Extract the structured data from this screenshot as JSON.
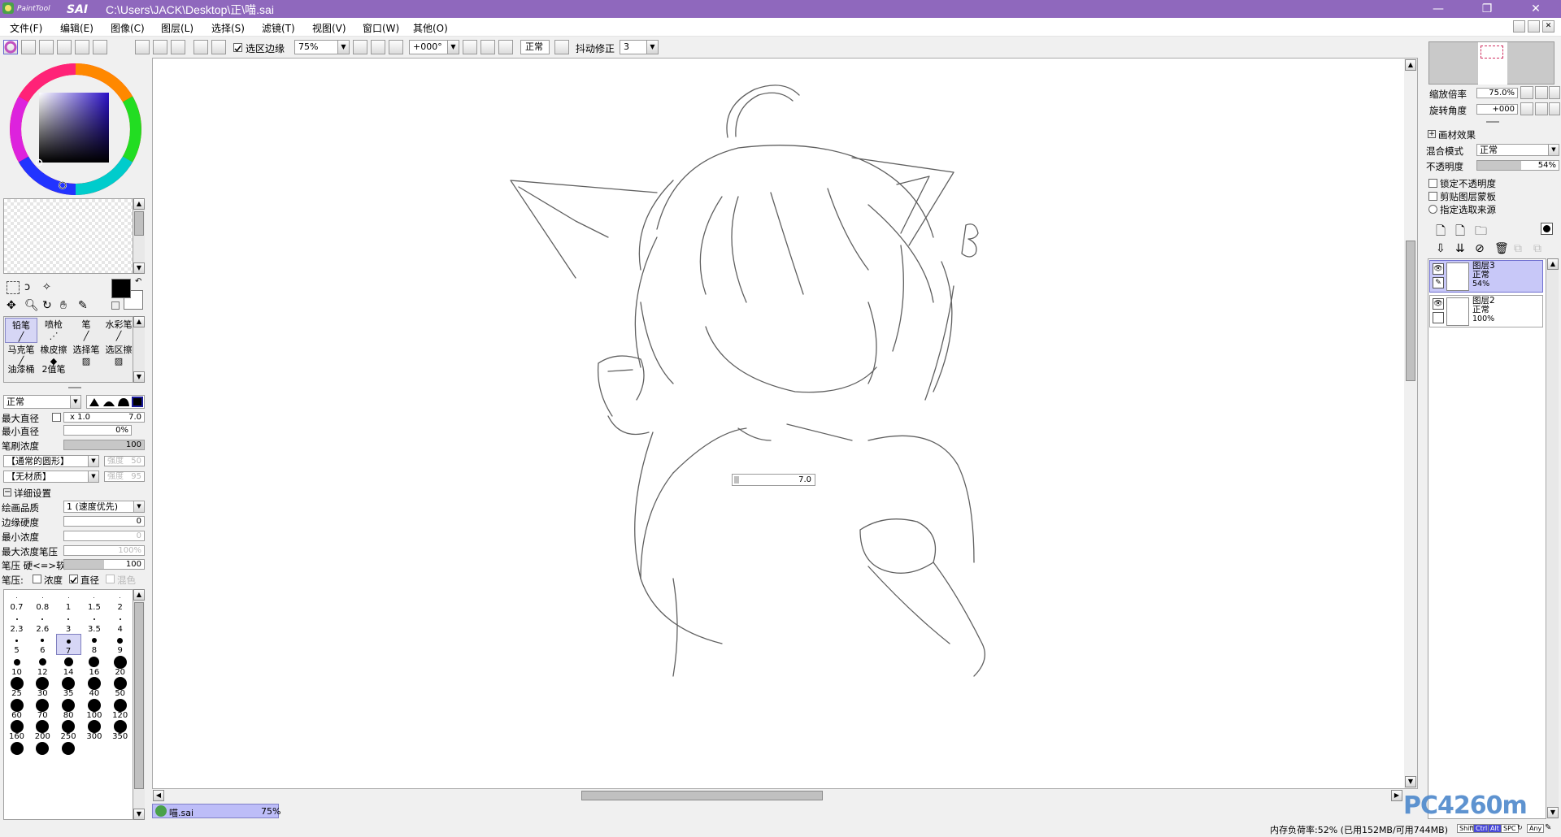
{
  "window": {
    "app_logo_text": "PaintTool SAI",
    "title": "C:\\Users\\JACK\\Desktop\\正\\喵.sai",
    "minimize": "—",
    "maximize": "❐",
    "close": "✕",
    "title_color": "#8f68bd"
  },
  "menu": [
    "文件(F)",
    "编辑(E)",
    "图像(C)",
    "图层(L)",
    "选择(S)",
    "滤镜(T)",
    "视图(V)",
    "窗口(W)",
    "其他(O)"
  ],
  "toolbar": {
    "selection_edge_label": "选区边缘",
    "selection_edge_checked": true,
    "zoom": "75%",
    "rotation": "+000°",
    "mode": "正常",
    "stabilizer_label": "抖动修正",
    "stabilizer_value": "3"
  },
  "color_panel": {
    "primary_color": "#000000",
    "secondary_color": "#ffffff",
    "square_hue": "#2a10c8"
  },
  "tools": [
    {
      "label": "铅笔",
      "selected": true
    },
    {
      "label": "喷枪",
      "selected": false
    },
    {
      "label": "笔",
      "selected": false
    },
    {
      "label": "水彩笔",
      "selected": false
    },
    {
      "label": "马克笔",
      "selected": false
    },
    {
      "label": "橡皮擦",
      "selected": false
    },
    {
      "label": "选择笔",
      "selected": false
    },
    {
      "label": "选区擦",
      "selected": false
    },
    {
      "label": "油漆桶",
      "selected": false
    },
    {
      "label": "2值笔",
      "selected": false
    }
  ],
  "brush": {
    "blend_mode": "正常",
    "max_diameter_label": "最大直径",
    "max_diameter_mult": "x 1.0",
    "max_diameter_value": "7.0",
    "min_diameter_label": "最小直径",
    "min_diameter_value": "0%",
    "density_label": "笔刷浓度",
    "density_value": "100",
    "shape_combo": "【通常的圆形】",
    "shape_strength_label": "强度",
    "shape_strength_value": "50",
    "texture_combo": "【无材质】",
    "texture_strength_label": "强度",
    "texture_strength_value": "95",
    "details_label": "详细设置",
    "quality_label": "绘画品质",
    "quality_value": "1 (速度优先)",
    "edge_hardness_label": "边缘硬度",
    "edge_hardness_value": "0",
    "min_density_label": "最小浓度",
    "min_density_value": "0",
    "max_density_pressure_label": "最大浓度笔压",
    "max_density_pressure_value": "100%",
    "pressure_hardness_label": "笔压 硬<=>软",
    "pressure_hardness_value": "100",
    "pressure_label": "笔压:",
    "pressure_density_label": "浓度",
    "pressure_density_checked": false,
    "pressure_diameter_label": "直径",
    "pressure_diameter_checked": true,
    "pressure_mix_label": "混色"
  },
  "brush_sizes": [
    {
      "label": "0.7",
      "size": 1
    },
    {
      "label": "0.8",
      "size": 1
    },
    {
      "label": "1",
      "size": 1
    },
    {
      "label": "1.5",
      "size": 1
    },
    {
      "label": "2",
      "size": 1
    },
    {
      "label": "2.3",
      "size": 2
    },
    {
      "label": "2.6",
      "size": 2
    },
    {
      "label": "3",
      "size": 2
    },
    {
      "label": "3.5",
      "size": 2
    },
    {
      "label": "4",
      "size": 2
    },
    {
      "label": "5",
      "size": 3
    },
    {
      "label": "6",
      "size": 4
    },
    {
      "label": "7",
      "size": 5
    },
    {
      "label": "8",
      "size": 6
    },
    {
      "label": "9",
      "size": 7
    },
    {
      "label": "10",
      "size": 8
    },
    {
      "label": "12",
      "size": 9
    },
    {
      "label": "14",
      "size": 11
    },
    {
      "label": "16",
      "size": 13
    },
    {
      "label": "20",
      "size": 16
    },
    {
      "label": "25",
      "size": 16
    },
    {
      "label": "30",
      "size": 16
    },
    {
      "label": "35",
      "size": 16
    },
    {
      "label": "40",
      "size": 16
    },
    {
      "label": "50",
      "size": 16
    },
    {
      "label": "60",
      "size": 16
    },
    {
      "label": "70",
      "size": 16
    },
    {
      "label": "80",
      "size": 16
    },
    {
      "label": "100",
      "size": 16
    },
    {
      "label": "120",
      "size": 16
    },
    {
      "label": "160",
      "size": 16
    },
    {
      "label": "200",
      "size": 16
    },
    {
      "label": "250",
      "size": 16
    },
    {
      "label": "300",
      "size": 16
    },
    {
      "label": "350",
      "size": 16
    },
    {
      "label": "",
      "size": 16
    },
    {
      "label": "",
      "size": 16
    },
    {
      "label": "",
      "size": 16
    }
  ],
  "selected_brush_size": "7",
  "canvas": {
    "size_popup_value": "7.0",
    "doc_tab_name": "喵.sai",
    "doc_tab_zoom": "75%"
  },
  "navigator": {
    "zoom_label": "缩放倍率",
    "zoom_value": "75.0%",
    "rotate_label": "旋转角度",
    "rotate_value": "+000"
  },
  "layer_panel": {
    "effects_label": "画材效果",
    "blend_label": "混合模式",
    "blend_value": "正常",
    "opacity_label": "不透明度",
    "opacity_value": "54%",
    "opacity_fraction": 0.54,
    "lock_opacity_label": "锁定不透明度",
    "clip_label": "剪贴图层蒙板",
    "select_source_label": "指定选取来源",
    "layers": [
      {
        "name": "图层3",
        "mode": "正常",
        "opacity": "54%",
        "selected": true
      },
      {
        "name": "图层2",
        "mode": "正常",
        "opacity": "100%",
        "selected": false
      }
    ]
  },
  "status": {
    "memory": "内存负荷率:52% (已用152MB/可用744MB)",
    "keys": [
      "Shift",
      "Ctrl",
      "Alt",
      "SPC",
      "Any"
    ],
    "watermark": "PC4260m"
  }
}
